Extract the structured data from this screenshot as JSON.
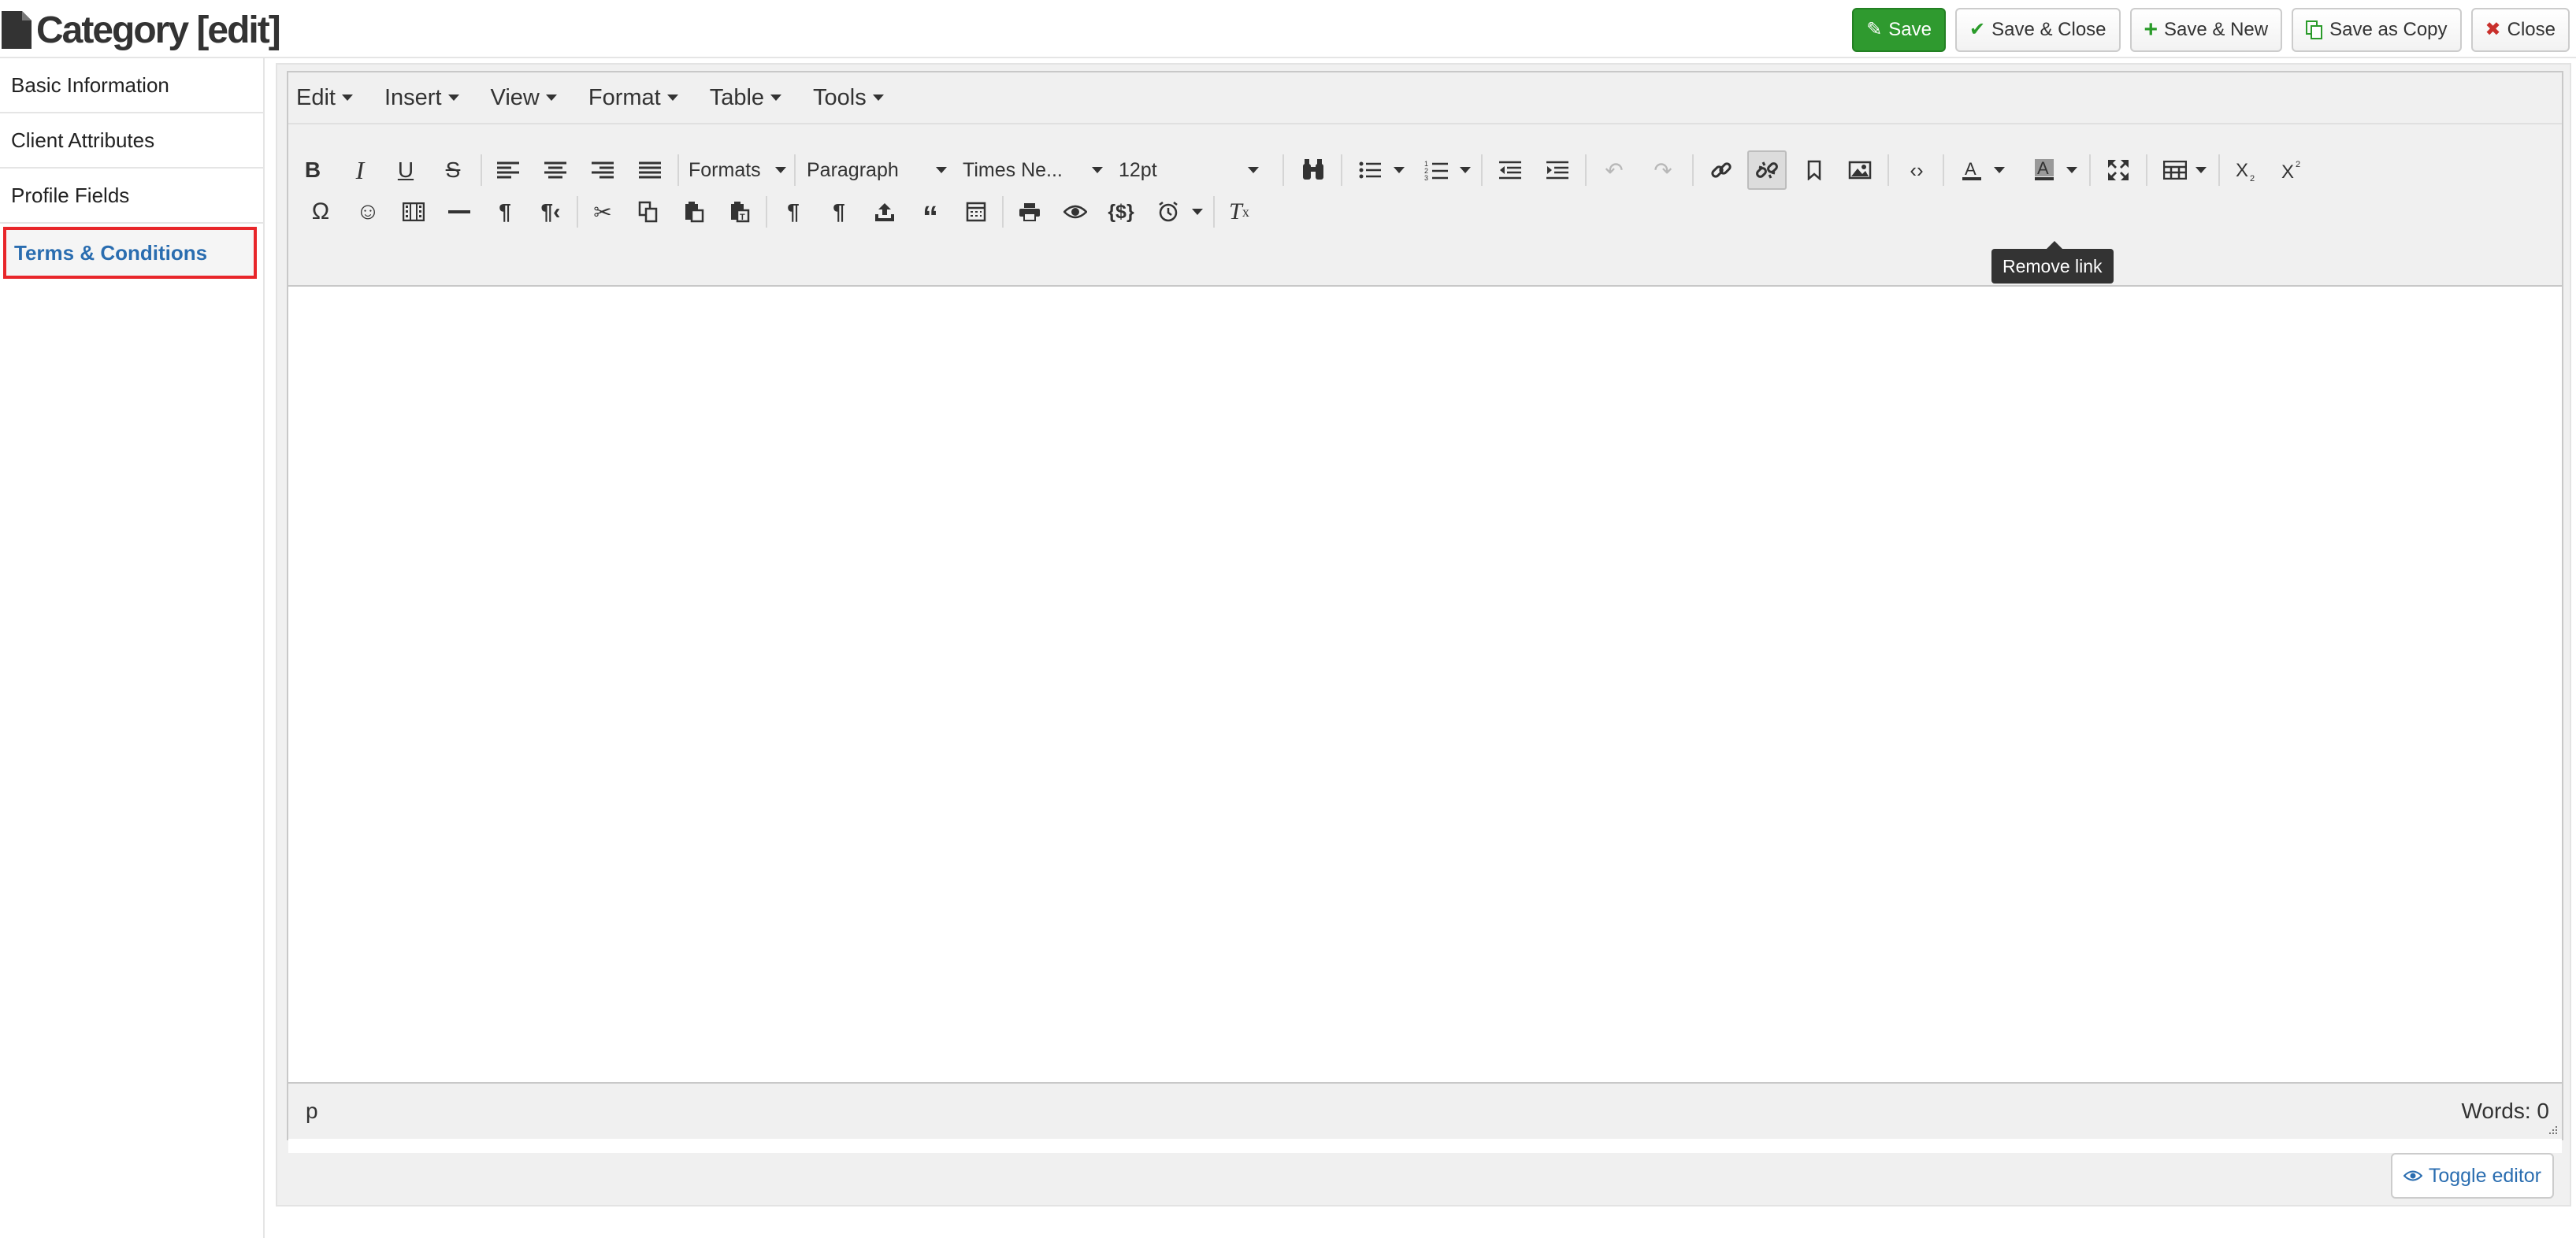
{
  "header": {
    "title": "Category [edit]",
    "buttons": {
      "save": "Save",
      "save_close": "Save & Close",
      "save_new": "Save & New",
      "save_copy": "Save as Copy",
      "close": "Close"
    }
  },
  "sidebar": {
    "items": [
      {
        "label": "Basic Information"
      },
      {
        "label": "Client Attributes"
      },
      {
        "label": "Profile Fields"
      },
      {
        "label": "Terms & Conditions",
        "active": true
      }
    ]
  },
  "editor": {
    "menus": [
      "Edit",
      "Insert",
      "View",
      "Format",
      "Table",
      "Tools"
    ],
    "formats_label": "Formats",
    "block_format": "Paragraph",
    "font_family": "Times Ne...",
    "font_size": "12pt",
    "tooltip": "Remove link",
    "status_path": "p",
    "word_count": "Words: 0"
  },
  "toggle_editor": "Toggle editor",
  "colors": {
    "save_green": "#2f9a2f",
    "active_link": "#2a6db0",
    "highlight_border": "#e8262a"
  }
}
